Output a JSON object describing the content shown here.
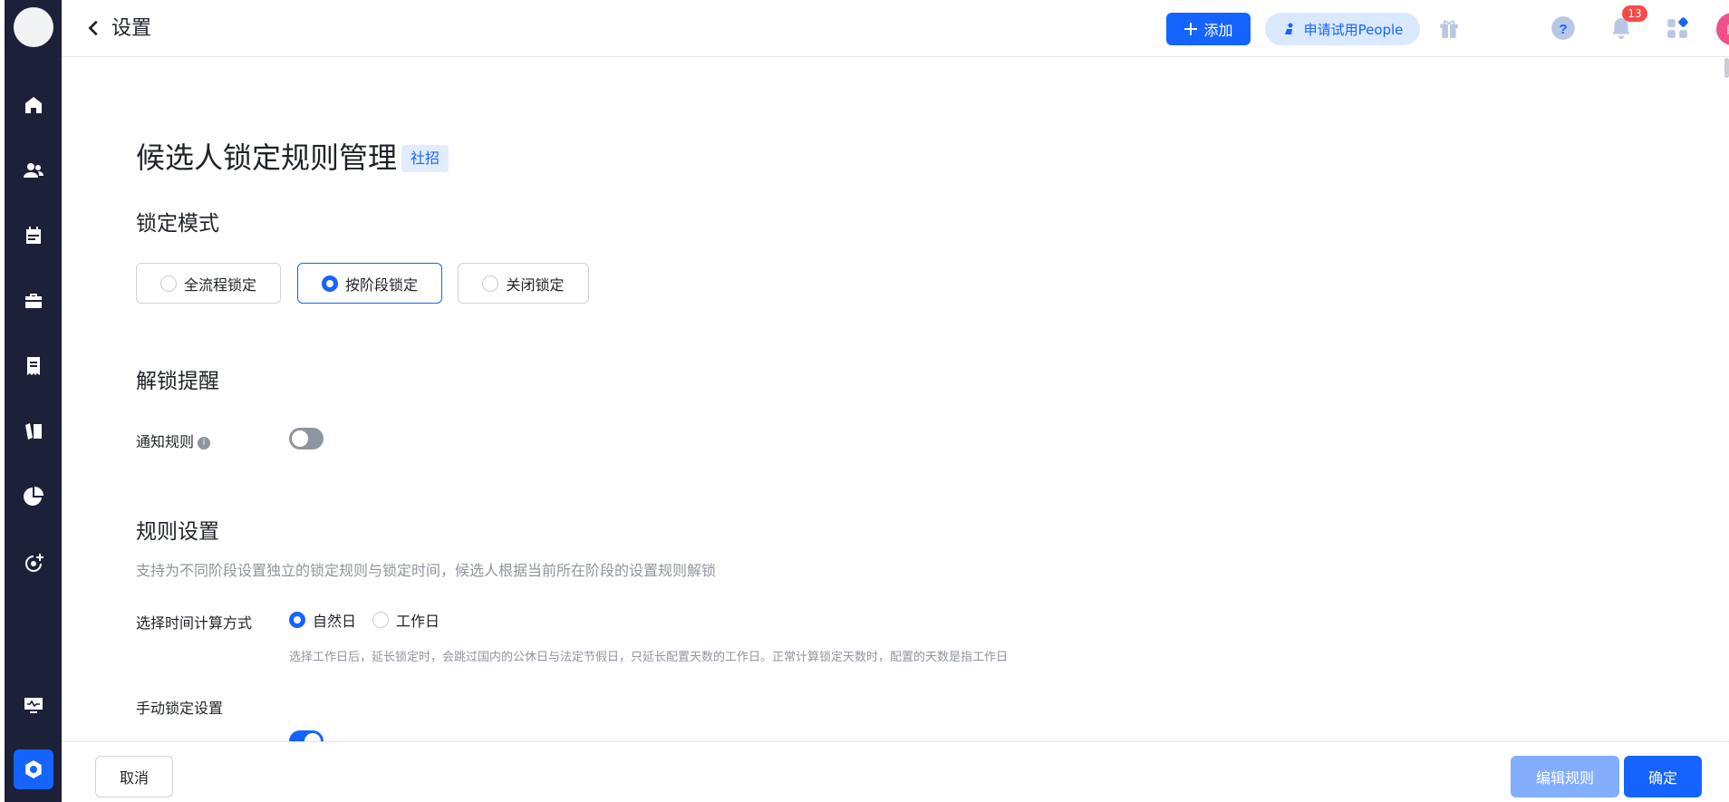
{
  "topbar": {
    "title": "设置",
    "add_label": "添加",
    "trial_label": "申请试用People",
    "notification_count": "13",
    "avatar_text": "盼"
  },
  "page": {
    "title": "候选人锁定规则管理",
    "tag": "社招"
  },
  "lock_mode": {
    "title": "锁定模式",
    "options": [
      "全流程锁定",
      "按阶段锁定",
      "关闭锁定"
    ],
    "selected": "按阶段锁定"
  },
  "unlock_reminder": {
    "title": "解锁提醒",
    "notify_label": "通知规则",
    "notify_enabled": false
  },
  "rules": {
    "title": "规则设置",
    "desc": "支持为不同阶段设置独立的锁定规则与锁定时间，候选人根据当前所在阶段的设置规则解锁",
    "time_calc_label": "选择时间计算方式",
    "time_options": [
      "自然日",
      "工作日"
    ],
    "time_selected": "自然日",
    "time_hint": "选择工作日后，延长锁定时，会跳过国内的公休日与法定节假日，只延长配置天数的工作日。正常计算锁定天数时，配置的天数是指工作日",
    "manual_lock_label": "手动锁定设置",
    "manual_lock_enabled": true
  },
  "footer": {
    "cancel_label": "取消",
    "edit_label": "编辑规则",
    "ok_label": "确定"
  },
  "colors": {
    "brand": "#1664ff",
    "rail": "#1c2038",
    "avatar": "#f0508a",
    "badge": "#f54a45"
  }
}
